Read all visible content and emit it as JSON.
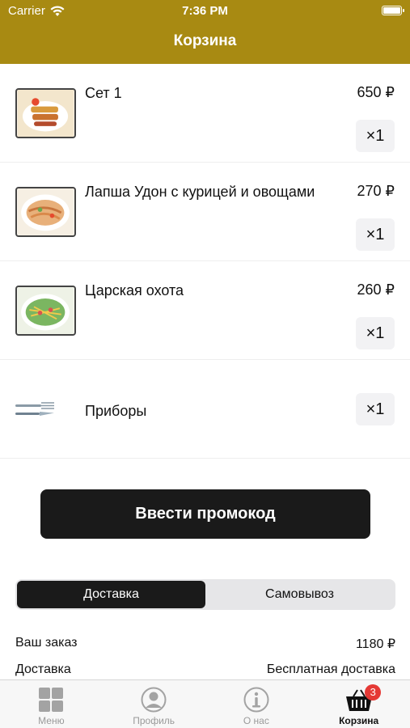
{
  "status_bar": {
    "carrier": "Carrier",
    "time": "7:36 PM"
  },
  "nav": {
    "title": "Корзина"
  },
  "cart": {
    "items": [
      {
        "name": "Сет 1",
        "price": "650 ₽",
        "qty": "×1",
        "image": "set-food-photo"
      },
      {
        "name": "Лапша Удон с курицей и овощами",
        "price": "270 ₽",
        "qty": "×1",
        "image": "udon-noodles-photo"
      },
      {
        "name": "Царская охота",
        "price": "260 ₽",
        "qty": "×1",
        "image": "salad-photo"
      }
    ],
    "cutlery": {
      "name": "Приборы",
      "qty": "×1",
      "image": "cutlery-photo"
    }
  },
  "promo": {
    "label": "Ввести промокод"
  },
  "delivery_toggle": {
    "options": [
      "Доставка",
      "Самовывоз"
    ],
    "selected": "Доставка"
  },
  "summary": {
    "order_label": "Ваш заказ",
    "order_value": "1180 ₽",
    "delivery_label": "Доставка",
    "delivery_value": "Бесплатная доставка"
  },
  "tab_bar": {
    "tabs": [
      {
        "label": "Меню",
        "icon": "grid-icon"
      },
      {
        "label": "Профиль",
        "icon": "profile-icon"
      },
      {
        "label": "О нас",
        "icon": "info-icon"
      },
      {
        "label": "Корзина",
        "icon": "basket-icon",
        "badge": "3",
        "active": true
      }
    ]
  },
  "colors": {
    "header": "#a88a12",
    "button": "#1a1a1a",
    "badge": "#e53935"
  }
}
